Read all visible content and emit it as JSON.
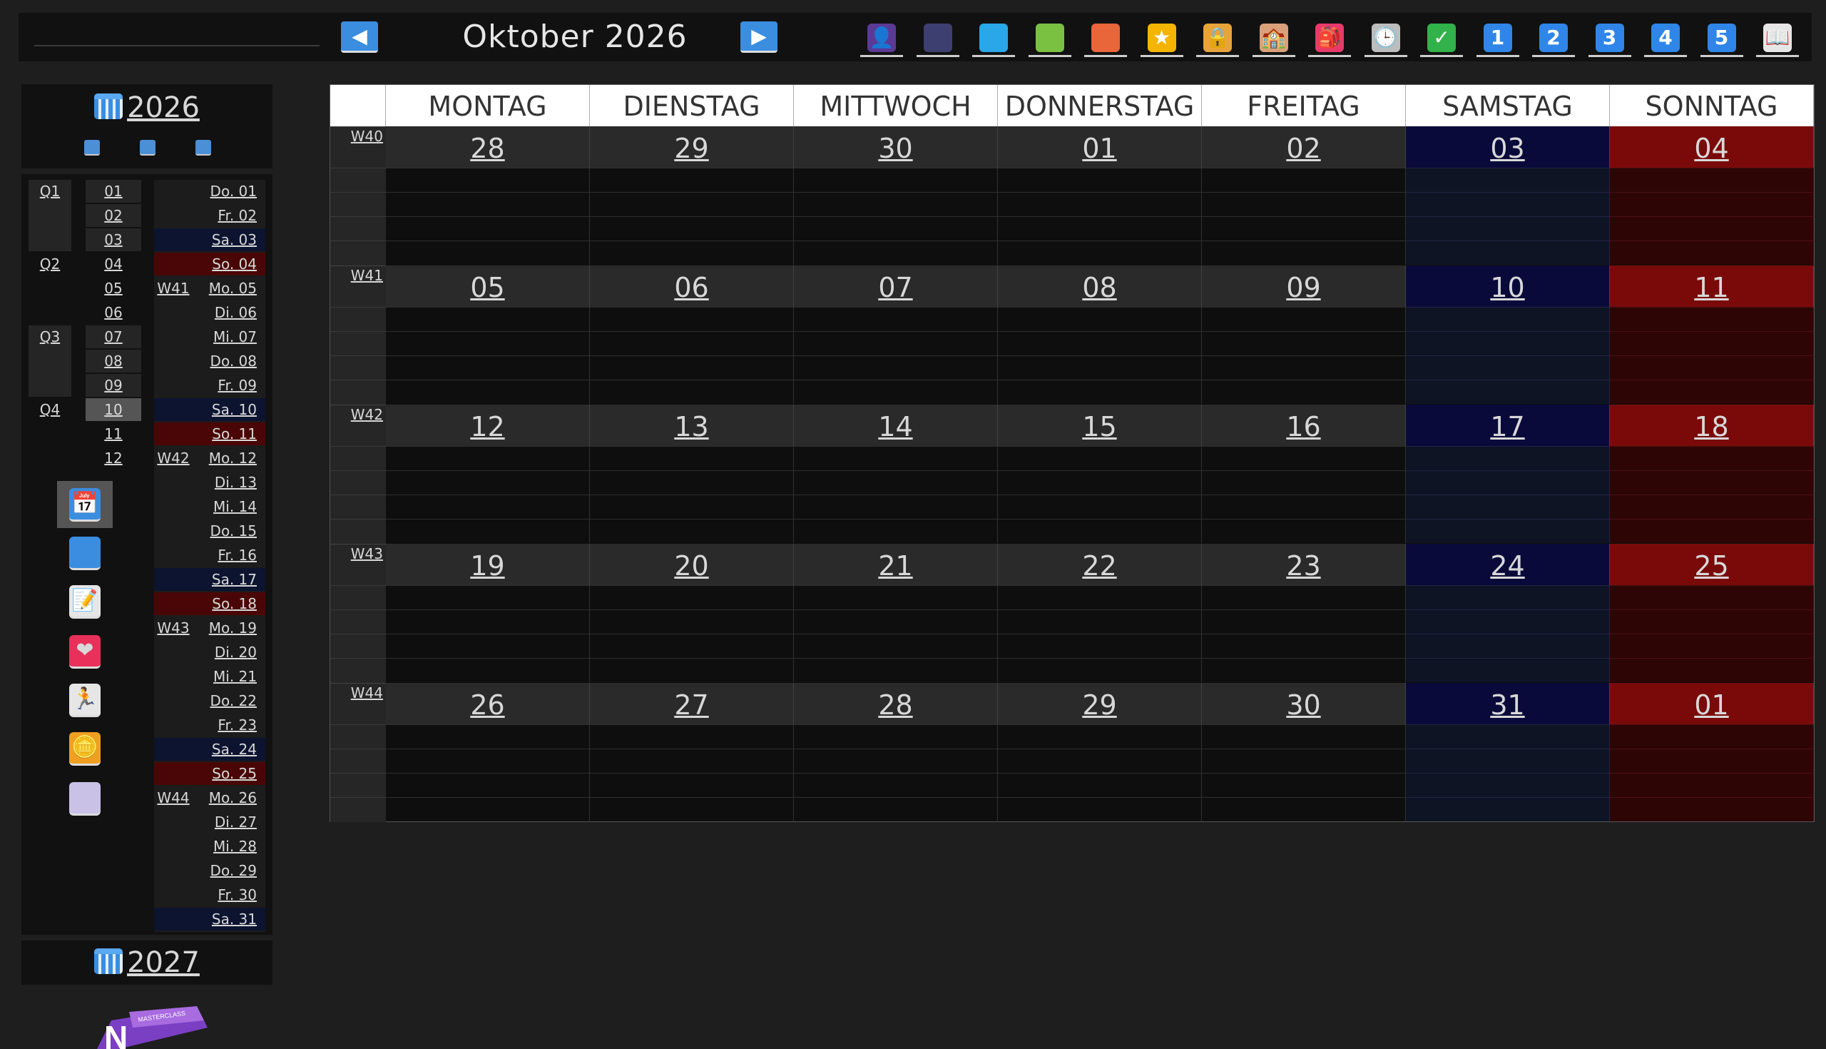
{
  "header": {
    "title": "Oktober 2026",
    "prev_label": "◀",
    "next_label": "▶",
    "toolbar_icons": [
      {
        "name": "person-icon",
        "glyph": "👤",
        "color": "#5b3a96"
      },
      {
        "name": "notebook-dark-icon",
        "glyph": "",
        "color": "#3d3f70"
      },
      {
        "name": "notebook-blue-icon",
        "glyph": "",
        "color": "#2aa7e8"
      },
      {
        "name": "notebook-green-icon",
        "glyph": "",
        "color": "#7ac142"
      },
      {
        "name": "notebook-orange-icon",
        "glyph": "",
        "color": "#e9653a"
      },
      {
        "name": "star-icon",
        "glyph": "★",
        "color": "#f4b400"
      },
      {
        "name": "lock-icon",
        "glyph": "🔒",
        "color": "#e8a33a"
      },
      {
        "name": "school-icon",
        "glyph": "🏫",
        "color": "#d9a07a"
      },
      {
        "name": "backpack-icon",
        "glyph": "🎒",
        "color": "#e83a6a"
      },
      {
        "name": "clock-icon",
        "glyph": "🕒",
        "color": "#bdbdbd"
      },
      {
        "name": "check-icon",
        "glyph": "✓",
        "color": "#31b24a"
      },
      {
        "name": "number-1-icon",
        "glyph": "1",
        "color": "#2f86e8"
      },
      {
        "name": "number-2-icon",
        "glyph": "2",
        "color": "#2f86e8"
      },
      {
        "name": "number-3-icon",
        "glyph": "3",
        "color": "#2f86e8"
      },
      {
        "name": "number-4-icon",
        "glyph": "4",
        "color": "#2f86e8"
      },
      {
        "name": "number-5-icon",
        "glyph": "5",
        "color": "#2f86e8"
      },
      {
        "name": "open-book-icon",
        "glyph": "📖",
        "color": "#e6e6e6"
      }
    ]
  },
  "sidebar": {
    "year": "2026",
    "next_year": "2027",
    "quarters": [
      "Q1",
      "Q2",
      "Q3",
      "Q4"
    ],
    "months": [
      "01",
      "02",
      "03",
      "04",
      "05",
      "06",
      "07",
      "08",
      "09",
      "10",
      "11",
      "12"
    ],
    "selected_month": "10",
    "weeks": [
      {
        "label": "W41",
        "row": 4
      },
      {
        "label": "W42",
        "row": 11
      },
      {
        "label": "W43",
        "row": 18
      },
      {
        "label": "W44",
        "row": 25
      }
    ],
    "days": [
      {
        "label": "Do. 01",
        "type": "weekday"
      },
      {
        "label": "Fr. 02",
        "type": "weekday"
      },
      {
        "label": "Sa. 03",
        "type": "sat"
      },
      {
        "label": "So. 04",
        "type": "sun"
      },
      {
        "label": "Mo. 05",
        "type": "weekday"
      },
      {
        "label": "Di. 06",
        "type": "weekday"
      },
      {
        "label": "Mi. 07",
        "type": "weekday"
      },
      {
        "label": "Do. 08",
        "type": "weekday"
      },
      {
        "label": "Fr. 09",
        "type": "weekday"
      },
      {
        "label": "Sa. 10",
        "type": "sat"
      },
      {
        "label": "So. 11",
        "type": "sun"
      },
      {
        "label": "Mo. 12",
        "type": "weekday"
      },
      {
        "label": "Di. 13",
        "type": "weekday"
      },
      {
        "label": "Mi. 14",
        "type": "weekday"
      },
      {
        "label": "Do. 15",
        "type": "weekday"
      },
      {
        "label": "Fr. 16",
        "type": "weekday"
      },
      {
        "label": "Sa. 17",
        "type": "sat"
      },
      {
        "label": "So. 18",
        "type": "sun"
      },
      {
        "label": "Mo. 19",
        "type": "weekday"
      },
      {
        "label": "Di. 20",
        "type": "weekday"
      },
      {
        "label": "Mi. 21",
        "type": "weekday"
      },
      {
        "label": "Do. 22",
        "type": "weekday"
      },
      {
        "label": "Fr. 23",
        "type": "weekday"
      },
      {
        "label": "Sa. 24",
        "type": "sat"
      },
      {
        "label": "So. 25",
        "type": "sun"
      },
      {
        "label": "Mo. 26",
        "type": "weekday"
      },
      {
        "label": "Di. 27",
        "type": "weekday"
      },
      {
        "label": "Mi. 28",
        "type": "weekday"
      },
      {
        "label": "Do. 29",
        "type": "weekday"
      },
      {
        "label": "Fr. 30",
        "type": "weekday"
      },
      {
        "label": "Sa. 31",
        "type": "sat"
      }
    ],
    "side_icons": [
      {
        "name": "calendar-month-icon",
        "glyph": "📅",
        "color": "#3b8de0"
      },
      {
        "name": "calendar-year-icon",
        "glyph": "",
        "color": "#3b8de0"
      },
      {
        "name": "notes-icon",
        "glyph": "📝",
        "color": "#e6e6e6"
      },
      {
        "name": "heart-icon",
        "glyph": "❤",
        "color": "#e8305a"
      },
      {
        "name": "runner-icon",
        "glyph": "🏃",
        "color": "#e6e6e6"
      },
      {
        "name": "coin-icon",
        "glyph": "🪙",
        "color": "#f0a020"
      },
      {
        "name": "book-icon",
        "glyph": "",
        "color": "#c9c1e6"
      }
    ],
    "logo_text": "MASTERCLASS"
  },
  "calendar": {
    "weekdays": [
      "MONTAG",
      "DIENSTAG",
      "MITTWOCH",
      "DONNERSTAG",
      "FREITAG",
      "SAMSTAG",
      "SONNTAG"
    ],
    "weeks": [
      {
        "label": "W40",
        "days": [
          "28",
          "29",
          "30",
          "01",
          "02",
          "03",
          "04"
        ]
      },
      {
        "label": "W41",
        "days": [
          "05",
          "06",
          "07",
          "08",
          "09",
          "10",
          "11"
        ]
      },
      {
        "label": "W42",
        "days": [
          "12",
          "13",
          "14",
          "15",
          "16",
          "17",
          "18"
        ]
      },
      {
        "label": "W43",
        "days": [
          "19",
          "20",
          "21",
          "22",
          "23",
          "24",
          "25"
        ]
      },
      {
        "label": "W44",
        "days": [
          "26",
          "27",
          "28",
          "29",
          "30",
          "31",
          "01"
        ]
      }
    ]
  },
  "colors": {
    "saturday": "#0a0a3a",
    "saturday_light": "#101528",
    "sunday": "#7a0a0a",
    "sunday_light": "#330606",
    "accent": "#3b8de0"
  }
}
